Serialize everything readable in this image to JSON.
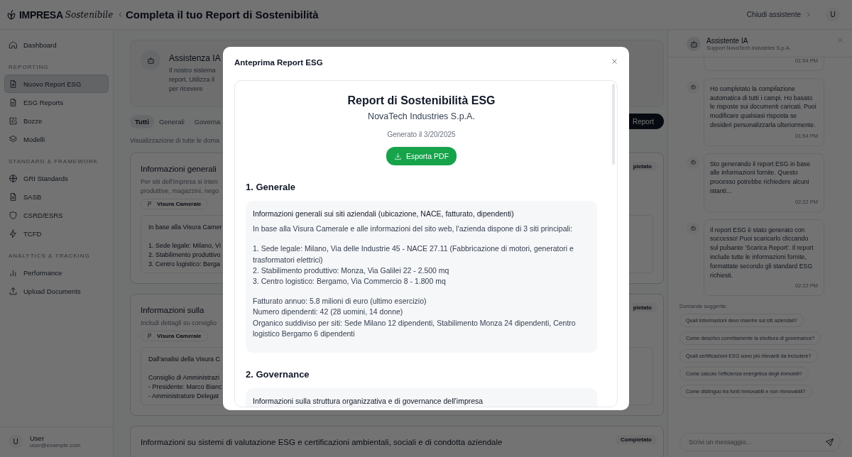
{
  "header": {
    "logo_main": "IMPRESA",
    "logo_script": "Sostenibile",
    "title": "Completa il tuo Report di Sostenibilità",
    "close_assistant": "Chiudi assistente",
    "avatar": "U"
  },
  "sidebar": {
    "sections": [
      {
        "items": [
          {
            "label": "Dashboard",
            "selected": false
          }
        ]
      },
      {
        "title": "REPORTING",
        "items": [
          {
            "label": "Nuovo Report ESG",
            "selected": true
          },
          {
            "label": "ESG Reports",
            "selected": false
          },
          {
            "label": "Bozze",
            "selected": false
          },
          {
            "label": "Modelli",
            "selected": false
          }
        ]
      },
      {
        "title": "STANDARD & FRAMEWORK",
        "items": [
          {
            "label": "GRI Standards",
            "selected": false
          },
          {
            "label": "SASB",
            "selected": false
          },
          {
            "label": "CSRD/ESRS",
            "selected": false
          },
          {
            "label": "TCFD",
            "selected": false
          }
        ]
      },
      {
        "title": "ANALYTICS & TRACKING",
        "items": [
          {
            "label": "Performance",
            "selected": false
          },
          {
            "label": "Upload Documents",
            "selected": false
          }
        ]
      }
    ],
    "user": {
      "avatar": "U",
      "name": "User",
      "email": "user@example.com"
    }
  },
  "main": {
    "assist": {
      "title": "Assistenza IA",
      "lines": [
        "Il nostro sistema",
        "report. Utilizza il",
        "per ricevere"
      ]
    },
    "tabs": [
      {
        "label": "Tutti",
        "selected": true
      },
      {
        "label": "Generali",
        "selected": false
      },
      {
        "label": "Governa",
        "selected": false
      }
    ],
    "report_button": "Report",
    "caption": "Visualizzazione di tutte le doma",
    "cards": [
      {
        "title": "Informazioni generali",
        "desc": [
          "Per siti dell'impresa si inten",
          "produttive, magazzini, nego"
        ],
        "chips": [
          "Visura Camerale"
        ],
        "badge": "pletato",
        "answer": [
          [
            "In base alla Visura Camer"
          ],
          [
            "1. Sede legale: Milano, Vi",
            "2. Stabilimento produttivo",
            "3. Centro logistico: Berga"
          ]
        ]
      },
      {
        "title": "Informazioni sulla",
        "desc": [
          "Includi dettagli su consiglio"
        ],
        "chips": [
          "Visura Camerale"
        ],
        "badge": "pletato",
        "answer": [
          [
            "Dall'analisi della Visura C"
          ],
          [
            "Consiglio di Amministrazi",
            "- Presidente: Marco Bianc",
            "- Amministratore Delegat"
          ]
        ]
      },
      {
        "title": "Informazioni su sistemi di valutazione ESG e certificazioni ambientali, sociali e di condotta aziendale",
        "badge": "Completato"
      }
    ]
  },
  "assistant": {
    "title": "Assistente IA",
    "subtitle": "Support NovaTech Industries S.p.A.",
    "messages": [
      {
        "time": "01:54 PM",
        "partial": true
      },
      {
        "text": "Ho completato la compilazione automatica di tutti i campi. Ho basato le risposte sui documenti caricati. Puoi modificare qualsiasi risposta se desideri personalizzarla ulteriormente.",
        "time": "01:54 PM"
      },
      {
        "text": "Sto generando il report ESG in base alle informazioni fornite. Questo processo potrebbe richiedere alcuni istanti...",
        "time": "02:22 PM"
      },
      {
        "text": "Il report ESG è stato generato con successo! Puoi scaricarlo cliccando sul pulsante 'Scarica Report'. Il report include tutte le informazioni fornite, formattate secondo gli standard ESG richiesti.",
        "time": "02:22 PM"
      }
    ],
    "suggest_title": "Domande suggerite:",
    "suggestions": [
      "Quali informazioni devo inserire sui siti aziendali?",
      "Come descrivo correttamente la struttura di governance?",
      "Quali certificazioni ESG sono più rilevanti da includere?",
      "Come calcolo l'efficienza energetica degli immobili?",
      "Come distinguo tra fonti rinnovabili e non rinnovabili?"
    ],
    "input": {
      "placeholder": "Scrivi un messaggio..."
    }
  },
  "modal": {
    "title": "Anteprima Report ESG",
    "doc_title": "Report di Sostenibilità ESG",
    "company": "NovaTech Industries S.p.A.",
    "date": "Generato il 3/20/2025",
    "export": "Esporta PDF",
    "sections": [
      {
        "title": "1. Generale",
        "items": [
          {
            "question": "Informazioni generali sui siti aziendali (ubicazione, NACE, fatturato, dipendenti)",
            "answer": [
              [
                "In base alla Visura Camerale e alle informazioni del sito web, l'azienda dispone di 3 siti principali:"
              ],
              [
                "1. Sede legale: Milano, Via delle Industrie 45 - NACE 27.11 (Fabbricazione di motori, generatori e trasformatori elettrici)",
                "2. Stabilimento produttivo: Monza, Via Galilei 22 - 2.500 mq",
                "3. Centro logistico: Bergamo, Via Commercio 8 - 1.800 mq"
              ],
              [
                "Fatturato annuo: 5.8 milioni di euro (ultimo esercizio)",
                "Numero dipendenti: 42 (28 uomini, 14 donne)",
                "Organico suddiviso per siti: Sede Milano 12 dipendenti, Stabilimento Monza 24 dipendenti, Centro logistico Bergamo 6 dipendenti"
              ]
            ]
          }
        ]
      },
      {
        "title": "2. Governance",
        "items": [
          {
            "question": "Informazioni sulla struttura organizzativa e di governance dell'impresa"
          }
        ]
      }
    ]
  }
}
